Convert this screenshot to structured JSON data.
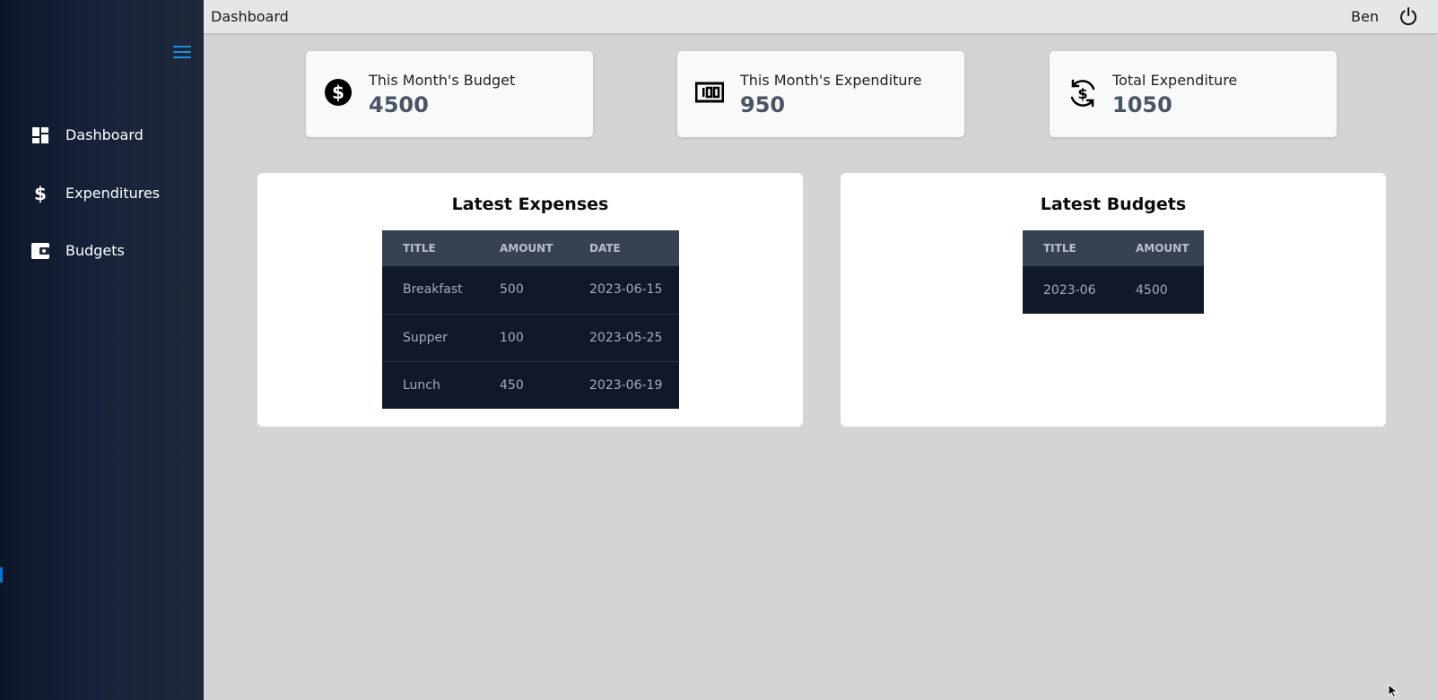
{
  "sidebar": {
    "menu_icon": "hamburger-icon",
    "items": [
      {
        "label": "Dashboard",
        "icon": "dashboard-grid-icon"
      },
      {
        "label": "Expenditures",
        "icon": "dollar-icon"
      },
      {
        "label": "Budgets",
        "icon": "wallet-icon"
      }
    ]
  },
  "topbar": {
    "title": "Dashboard",
    "user": "Ben",
    "logout_icon": "power-icon"
  },
  "stats": [
    {
      "label": "This Month's Budget",
      "value": "4500",
      "icon": "dollar-circle-icon"
    },
    {
      "label": "This Month's Expenditure",
      "value": "950",
      "icon": "money-bill-icon"
    },
    {
      "label": "Total Expenditure",
      "value": "1050",
      "icon": "dollar-sync-icon"
    }
  ],
  "expenses": {
    "title": "Latest Expenses",
    "columns": [
      "Title",
      "Amount",
      "Date"
    ],
    "rows": [
      [
        "Breakfast",
        "500",
        "2023-06-15"
      ],
      [
        "Supper",
        "100",
        "2023-05-25"
      ],
      [
        "Lunch",
        "450",
        "2023-06-19"
      ]
    ]
  },
  "budgets": {
    "title": "Latest Budgets",
    "columns": [
      "Title",
      "Amount"
    ],
    "rows": [
      [
        "2023-06",
        "4500"
      ]
    ]
  },
  "colors": {
    "accent": "#1e8fe0",
    "sidebar": "#1e293b",
    "table_header": "#374151",
    "table_body": "#111827",
    "page_bg": "#d4d4d4"
  }
}
